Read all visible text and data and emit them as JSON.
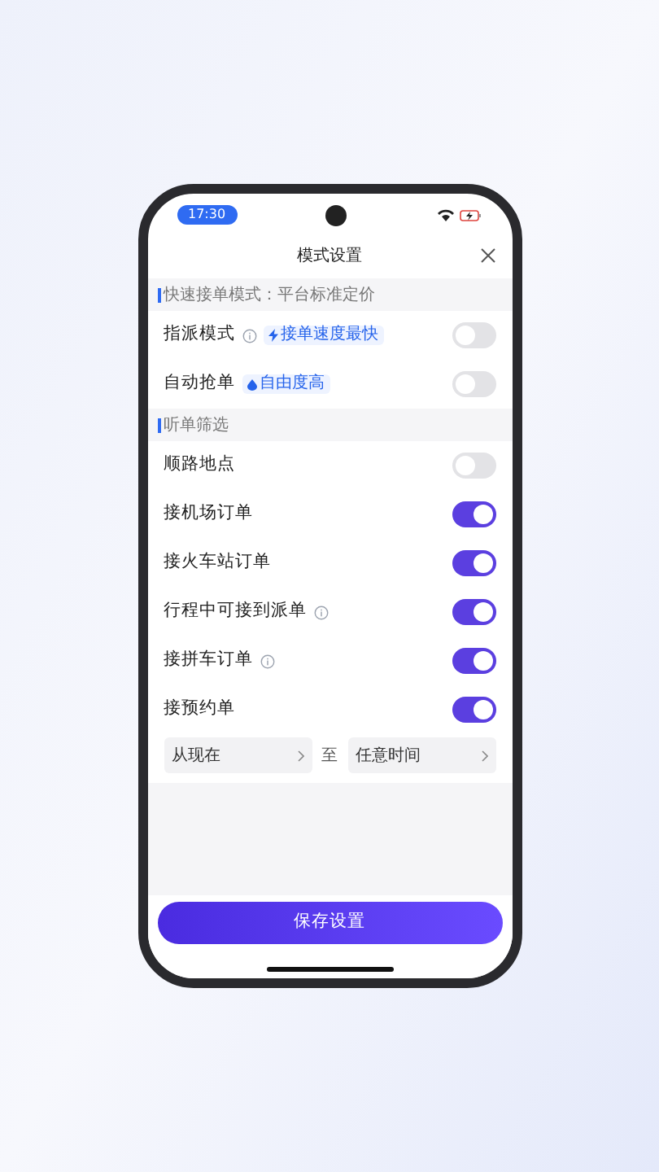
{
  "status_bar": {
    "time": "17:30"
  },
  "header": {
    "title": "模式设置"
  },
  "sections": [
    {
      "title": "快速接单模式：平台标准定价",
      "items": [
        {
          "label": "指派模式",
          "info": true,
          "tag": {
            "text": "接单速度最快",
            "kind": "bolt"
          },
          "on": false
        },
        {
          "label": "自动抢单",
          "info": false,
          "tag": {
            "text": "自由度高",
            "kind": "drop"
          },
          "on": false
        }
      ]
    },
    {
      "title": "听单筛选",
      "items": [
        {
          "label": "顺路地点",
          "info": false,
          "on": false
        },
        {
          "label": "接机场订单",
          "info": false,
          "on": true
        },
        {
          "label": "接火车站订单",
          "info": false,
          "on": true
        },
        {
          "label": "行程中可接到派单",
          "info": true,
          "on": true
        },
        {
          "label": "接拼车订单",
          "info": true,
          "on": true
        },
        {
          "label": "接预约单",
          "info": false,
          "on": true
        }
      ]
    }
  ],
  "time_range": {
    "from": "从现在",
    "separator": "至",
    "to": "任意时间"
  },
  "save_button": "保存设置"
}
